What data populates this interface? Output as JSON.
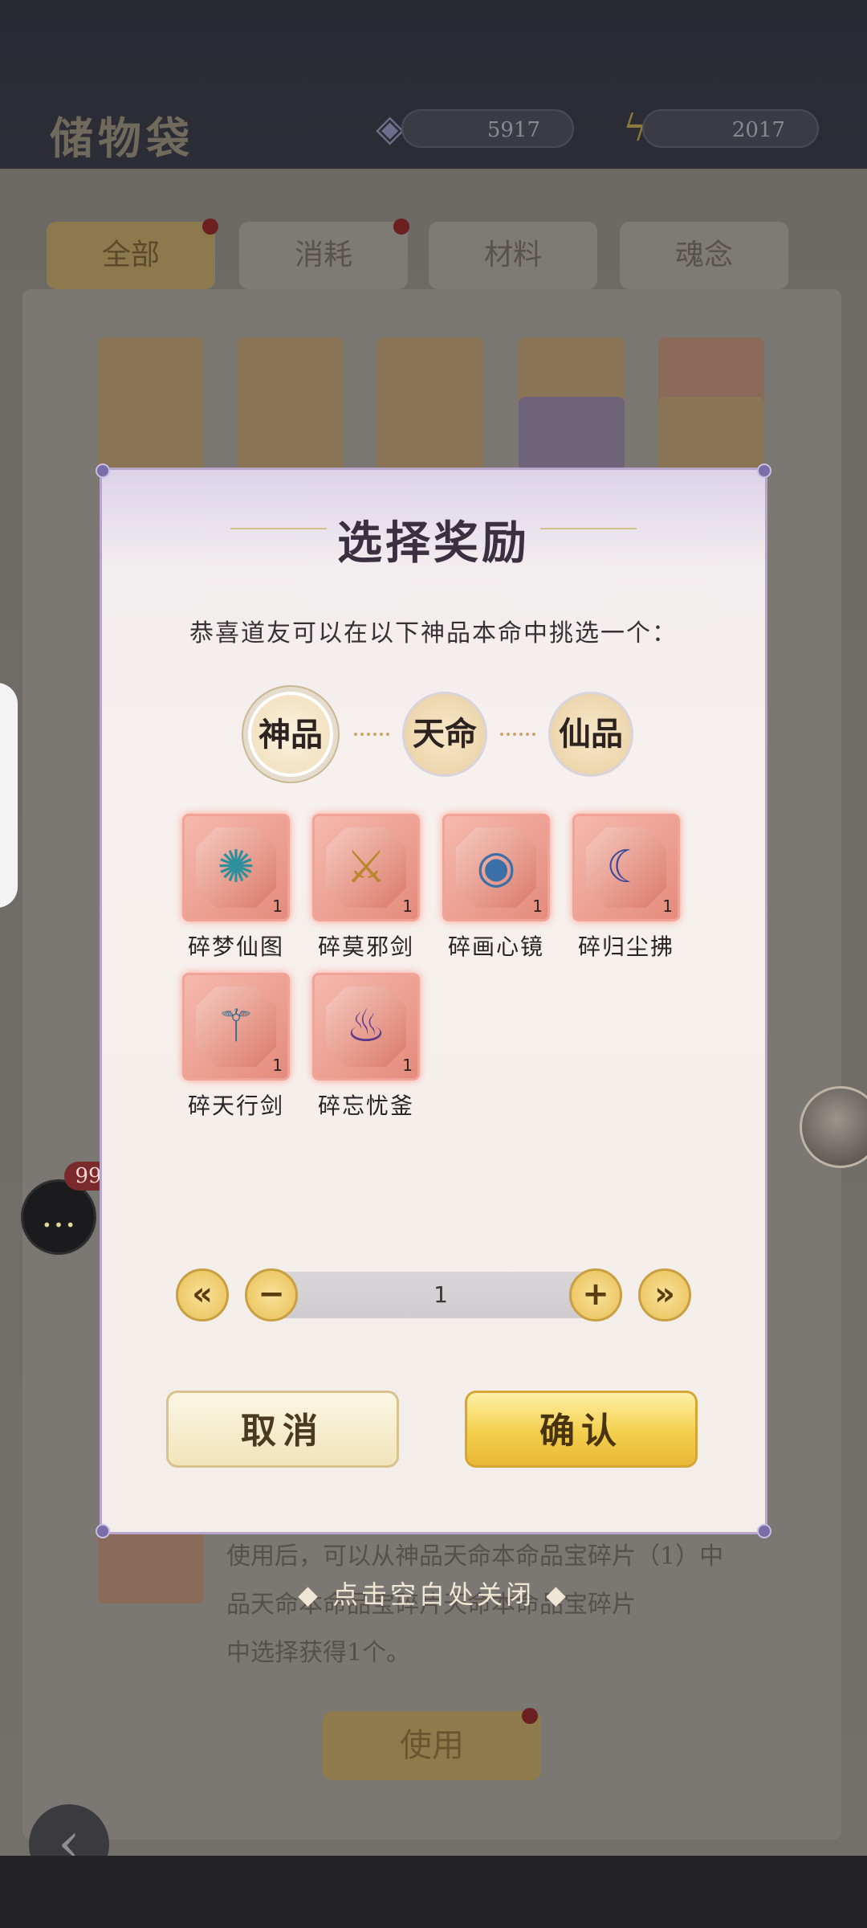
{
  "background": {
    "page_title": "储物袋",
    "resources": [
      {
        "icon": "spirit-stone-icon",
        "value": "5917"
      },
      {
        "icon": "lightning-icon",
        "value": "2017"
      }
    ],
    "tabs": [
      "全部",
      "消耗",
      "材料",
      "魂念"
    ],
    "description": "使用后，可以从神品天命本命品宝碎片（1）中\n品天命本命品宝碎片天命本命品宝碎片\n中选择获得1个。",
    "use_button": "使用",
    "chat_badge": "99"
  },
  "dialog": {
    "title": "选择奖励",
    "subtitle": "恭喜道友可以在以下神品本命中挑选一个：",
    "grades": [
      {
        "label": "神品",
        "selected": true
      },
      {
        "label": "天命",
        "selected": false
      },
      {
        "label": "仙品",
        "selected": false
      }
    ],
    "items": [
      {
        "name": "碎梦仙图",
        "count": "1",
        "icon": "dream-scroll-icon"
      },
      {
        "name": "碎莫邪剑",
        "count": "1",
        "icon": "moye-sword-icon"
      },
      {
        "name": "碎画心镜",
        "count": "1",
        "icon": "heart-mirror-icon"
      },
      {
        "name": "碎归尘拂",
        "count": "1",
        "icon": "dust-whisk-icon"
      },
      {
        "name": "碎天行剑",
        "count": "1",
        "icon": "sky-sword-icon"
      },
      {
        "name": "碎忘忧釜",
        "count": "1",
        "icon": "cauldron-icon"
      }
    ],
    "quantity": {
      "value": "1",
      "min_label": "«",
      "dec_label": "−",
      "inc_label": "+",
      "max_label": "»"
    },
    "cancel_label": "取消",
    "confirm_label": "确认"
  },
  "close_hint": "◆ 点击空白处关闭 ◆"
}
